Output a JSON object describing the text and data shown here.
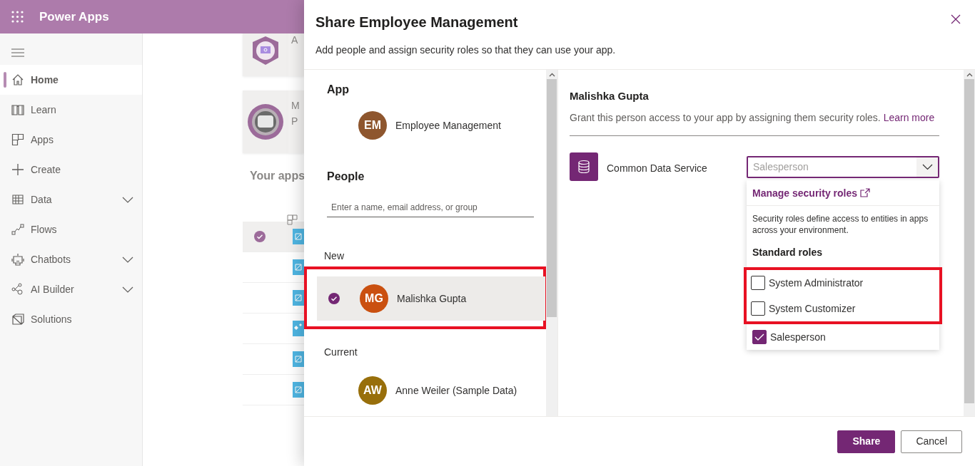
{
  "app_bar": {
    "title": "Power Apps"
  },
  "sidebar": {
    "items": [
      {
        "label": "Home",
        "kind": "home",
        "selected": true,
        "expandable": false
      },
      {
        "label": "Learn",
        "kind": "book",
        "selected": false,
        "expandable": false
      },
      {
        "label": "Apps",
        "kind": "apps",
        "selected": false,
        "expandable": false
      },
      {
        "label": "Create",
        "kind": "plus",
        "selected": false,
        "expandable": false
      },
      {
        "label": "Data",
        "kind": "table",
        "selected": false,
        "expandable": true
      },
      {
        "label": "Flows",
        "kind": "flow",
        "selected": false,
        "expandable": false
      },
      {
        "label": "Chatbots",
        "kind": "bot",
        "selected": false,
        "expandable": true
      },
      {
        "label": "AI Builder",
        "kind": "ai",
        "selected": false,
        "expandable": true
      },
      {
        "label": "Solutions",
        "kind": "solution",
        "selected": false,
        "expandable": false
      }
    ]
  },
  "background": {
    "cards": [
      {
        "title": "A",
        "kind": "monitor"
      },
      {
        "title": "M",
        "subtitle": "P",
        "kind": "badge"
      }
    ],
    "your_apps": {
      "title": "Your apps",
      "rows": [
        {
          "selected": true,
          "kind": "canvas"
        },
        {
          "selected": false,
          "kind": "canvas"
        },
        {
          "selected": false,
          "kind": "canvas"
        },
        {
          "selected": false,
          "kind": "model"
        },
        {
          "selected": false,
          "kind": "canvas"
        },
        {
          "selected": false,
          "kind": "canvas"
        }
      ]
    }
  },
  "dialog": {
    "title": "Share Employee Management",
    "subtitle": "Add people and assign security roles so that they can use your app.",
    "app_section": {
      "heading": "App",
      "app": {
        "initials": "EM",
        "name": "Employee Management",
        "color": "#8e562e"
      }
    },
    "people_section": {
      "heading": "People",
      "search": {
        "placeholder": "Enter a name, email address, or group"
      },
      "groups": [
        {
          "label": "New",
          "people": [
            {
              "initials": "MG",
              "name": "Malishka Gupta",
              "color": "#ca5010",
              "selected": true,
              "highlighted": true
            }
          ]
        },
        {
          "label": "Current",
          "people": [
            {
              "initials": "AW",
              "name": "Anne Weiler (Sample Data)",
              "color": "#986f0b",
              "selected": false,
              "highlighted": false
            }
          ]
        }
      ]
    },
    "detail": {
      "name": "Malishka Gupta",
      "description": "Grant this person access to your app by assigning them security roles.",
      "learn_more": "Learn more",
      "service": {
        "name": "Common Data Service",
        "dropdown": {
          "placeholder": "Salesperson",
          "expanded": true,
          "menu": {
            "manage_link": "Manage security roles",
            "info": "Security roles define access to entities in apps across your environment.",
            "group_heading": "Standard roles",
            "roles": [
              {
                "label": "System Administrator",
                "checked": false,
                "highlighted": true
              },
              {
                "label": "System Customizer",
                "checked": false,
                "highlighted": true
              },
              {
                "label": "Salesperson",
                "checked": true,
                "highlighted": false
              }
            ]
          }
        }
      }
    },
    "buttons": [
      {
        "label": "Share",
        "kind": "primary"
      },
      {
        "label": "Cancel",
        "kind": "secondary"
      }
    ]
  }
}
